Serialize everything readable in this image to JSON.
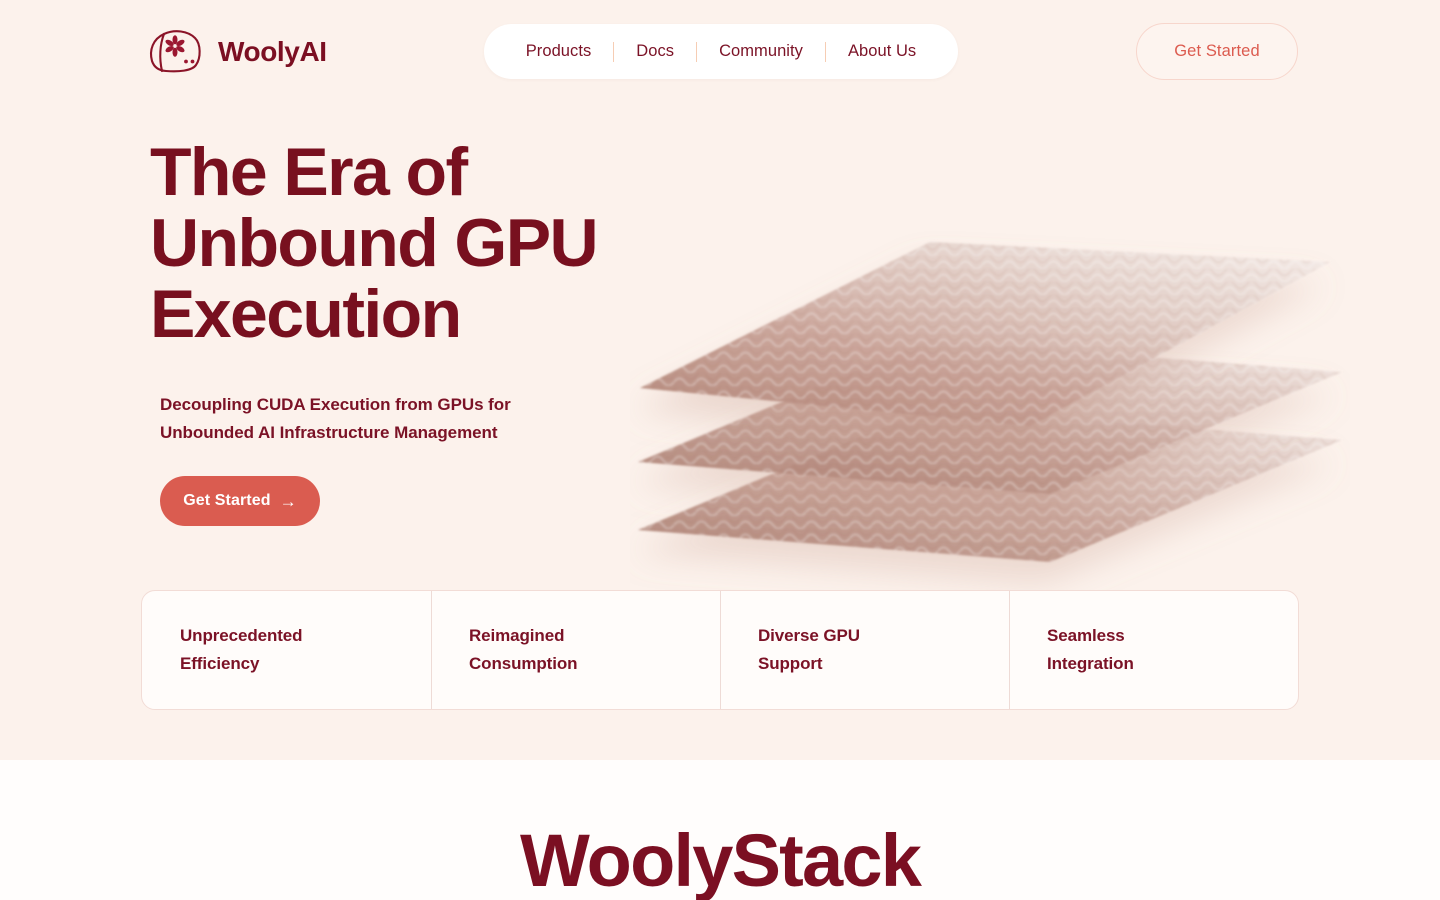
{
  "brand": {
    "name": "WoolyAI",
    "logo_icon": "sheep-pinwheel-logo"
  },
  "header": {
    "nav_items": [
      {
        "label": "Products"
      },
      {
        "label": "Docs"
      },
      {
        "label": "Community"
      },
      {
        "label": "About Us"
      }
    ],
    "cta_label": "Get Started"
  },
  "hero": {
    "title": "The Era of\nUnbound GPU\nExecution",
    "subtitle": "Decoupling CUDA Execution from GPUs for\nUnbounded AI Infrastructure Management",
    "cta_label": "Get Started",
    "cta_arrow": "→",
    "illustration": "stacked-translucent-layers"
  },
  "features": [
    {
      "label": "Unprecedented\nEfficiency"
    },
    {
      "label": "Reimagined\nConsumption"
    },
    {
      "label": "Diverse GPU\nSupport"
    },
    {
      "label": "Seamless\nIntegration"
    }
  ],
  "stack_section": {
    "title": "WoolyStack"
  },
  "colors": {
    "hero_background": "#FCF2EC",
    "section_background": "#FFFDFC",
    "brand_maroon": "#7B0F22",
    "text_maroon": "#7B1226",
    "accent_coral": "#DA5C50",
    "cta_outline": "#F7D6CC",
    "divider": "#EEDBD6",
    "nav_separator": "#F6CDB4",
    "card_background": "#FFFCFA"
  }
}
